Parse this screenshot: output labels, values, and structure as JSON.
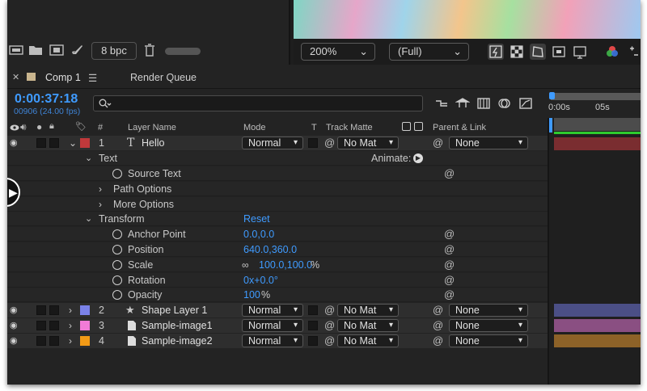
{
  "toolbar": {
    "bpc_label": "8 bpc",
    "zoom_value": "200%",
    "resolution_value": "(Full)"
  },
  "tabs": {
    "comp_label": "Comp 1",
    "render_queue_label": "Render Queue"
  },
  "comp": {
    "timecode": "0:00:37:18",
    "frame_fps": "00906 (24.00 fps)"
  },
  "ruler": {
    "labels": [
      "0:00s",
      "05s"
    ]
  },
  "columns": {
    "number": "#",
    "layer_name": "Layer Name",
    "mode": "Mode",
    "t": "T",
    "track_matte": "Track Matte",
    "parent_link": "Parent & Link"
  },
  "layers": [
    {
      "number": "1",
      "name": "Hello",
      "mode": "Normal",
      "matte": "No Mat",
      "parent": "None",
      "color": "#c0393b"
    },
    {
      "number": "2",
      "name": "Shape Layer 1",
      "mode": "Normal",
      "matte": "No Mat",
      "parent": "None",
      "color": "#7a82e8"
    },
    {
      "number": "3",
      "name": "Sample-image1",
      "mode": "Normal",
      "matte": "No Mat",
      "parent": "None",
      "color": "#f27bd7"
    },
    {
      "number": "4",
      "name": "Sample-image2",
      "mode": "Normal",
      "matte": "No Mat",
      "parent": "None",
      "color": "#f29a16"
    }
  ],
  "props": {
    "text_group": "Text",
    "animate_label": "Animate:",
    "source_text": "Source Text",
    "path_options": "Path Options",
    "more_options": "More Options",
    "transform_group": "Transform",
    "reset_label": "Reset",
    "anchor_point": "Anchor Point",
    "anchor_value": "0.0,0.0",
    "position": "Position",
    "position_value": "640.0,360.0",
    "scale": "Scale",
    "scale_value": "100.0,100.0",
    "scale_unit": "%",
    "rotation": "Rotation",
    "rotation_value": "0x+0.0°",
    "opacity": "Opacity",
    "opacity_value": "100",
    "opacity_unit": "%"
  },
  "timeline_colors": [
    "#7a2d30",
    "#4b4f86",
    "#8a4f82",
    "#8d6228"
  ]
}
